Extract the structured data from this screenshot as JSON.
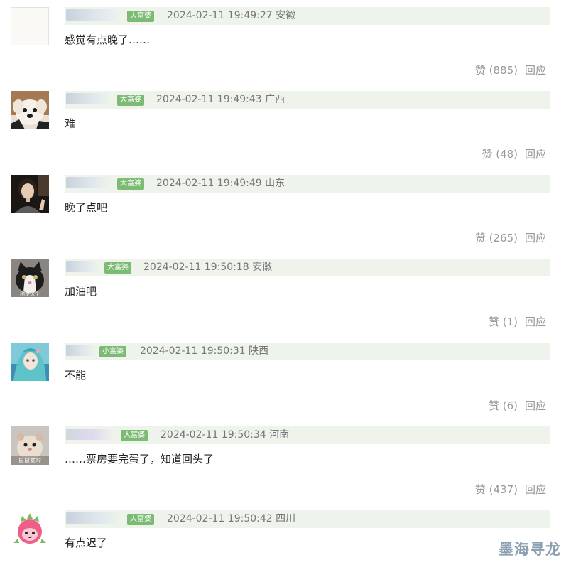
{
  "comments": [
    {
      "badge": "大富婆",
      "time_location": "2024-02-11 19:49:27 安徽",
      "text": "感觉有点晚了……",
      "like_label": "赞",
      "like_count": "(885)",
      "reply_label": "回应",
      "avatar_icon": "blank-avatar-icon"
    },
    {
      "badge": "大富婆",
      "time_location": "2024-02-11 19:49:43 广西",
      "text": "难",
      "like_label": "赞",
      "like_count": "(48)",
      "reply_label": "回应",
      "avatar_icon": "puppy-avatar-icon"
    },
    {
      "badge": "大富婆",
      "time_location": "2024-02-11 19:49:49 山东",
      "text": "晚了点吧",
      "like_label": "赞",
      "like_count": "(265)",
      "reply_label": "回应",
      "avatar_icon": "woman-avatar-icon"
    },
    {
      "badge": "大富婆",
      "time_location": "2024-02-11 19:50:18 安徽",
      "text": "加油吧",
      "like_label": "赞",
      "like_count": "(1)",
      "reply_label": "回应",
      "avatar_icon": "cat-avatar-icon",
      "avatar_caption": "称是这个"
    },
    {
      "badge": "小富婆",
      "time_location": "2024-02-11 19:50:31 陕西",
      "text": "不能",
      "like_label": "赞",
      "like_count": "(6)",
      "reply_label": "回应",
      "avatar_icon": "anime-avatar-icon"
    },
    {
      "badge": "大富婆",
      "time_location": "2024-02-11 19:50:34 河南",
      "text": "……票房要完蛋了，知道回头了",
      "like_label": "赞",
      "like_count": "(437)",
      "reply_label": "回应",
      "avatar_icon": "hamster-avatar-icon",
      "avatar_caption": "鼠鼠来啦"
    },
    {
      "badge": "大富婆",
      "time_location": "2024-02-11 19:50:42 四川",
      "text": "有点迟了",
      "avatar_icon": "dragonfruit-avatar-icon"
    }
  ],
  "watermark": "墨海寻龙",
  "colors": {
    "badge_bg": "#7cbb73",
    "meta_bg": "#eef3ec",
    "muted_text": "#999999"
  }
}
